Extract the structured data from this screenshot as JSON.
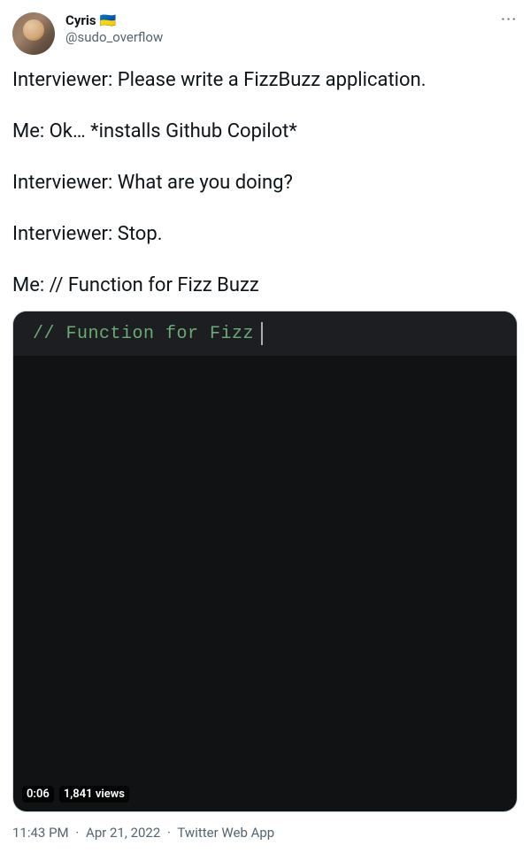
{
  "author": {
    "display_name": "Cyris",
    "flag_emoji": "🇺🇦",
    "handle": "@sudo_overflow"
  },
  "more_icon": "···",
  "body": "Interviewer: Please write a FizzBuzz application.\n\nMe: Ok… *installs Github Copilot*\n\nInterviewer: What are you doing?\n\nInterviewer: Stop.\n\nMe: // Function for Fizz Buzz",
  "media": {
    "code_text": "// Function for Fizz",
    "timestamp": "0:06",
    "views": "1,841 views"
  },
  "footer": {
    "time": "11:43 PM",
    "date": "Apr 21, 2022",
    "source": "Twitter Web App",
    "separator": "·"
  }
}
